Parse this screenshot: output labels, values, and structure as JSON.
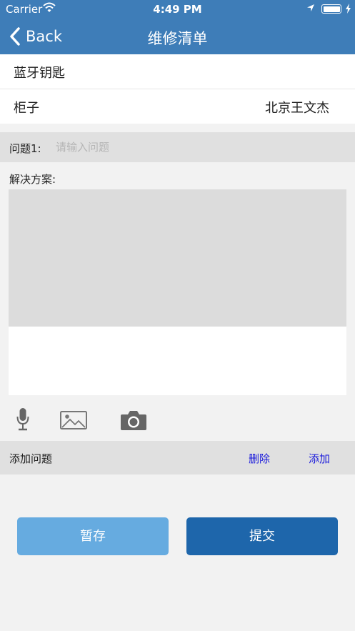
{
  "status_bar": {
    "carrier": "Carrier",
    "time": "4:49 PM"
  },
  "nav": {
    "back_label": "Back",
    "title": "维修清单"
  },
  "info": {
    "row1_left": "蓝牙钥匙",
    "row2_left": "柜子",
    "row2_right": "北京王文杰"
  },
  "question": {
    "label": "问题1:",
    "value": "",
    "placeholder": "请输入问题"
  },
  "solution": {
    "label": "解决方案:"
  },
  "media": {
    "mic_icon": "microphone-icon",
    "image_icon": "image-icon",
    "camera_icon": "camera-icon"
  },
  "add_row": {
    "label": "添加问题",
    "delete_label": "删除",
    "add_label": "添加"
  },
  "buttons": {
    "save_label": "暂存",
    "submit_label": "提交"
  },
  "colors": {
    "nav_bg": "#3e7db8",
    "link": "#1a1adb",
    "save_button": "#66abe0",
    "submit_button": "#1e66ab"
  }
}
